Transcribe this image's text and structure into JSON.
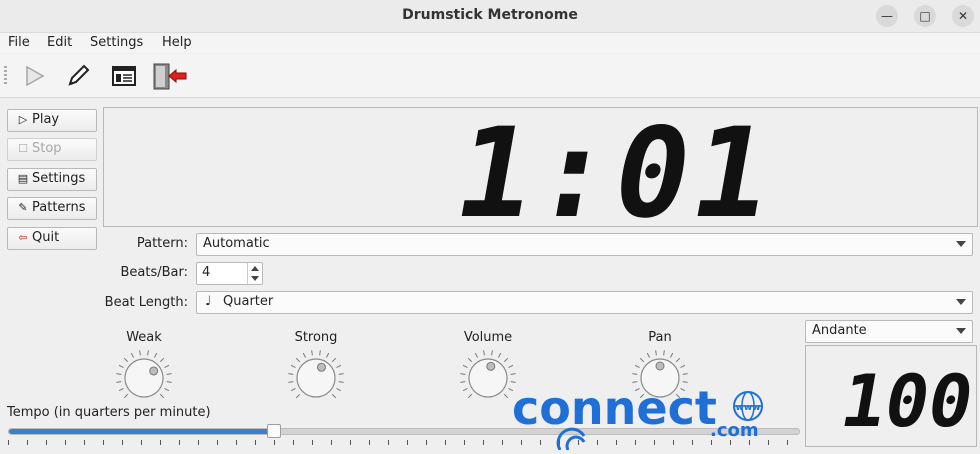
{
  "window": {
    "title": "Drumstick Metronome",
    "minimize_glyph": "—",
    "maximize_glyph": "□",
    "close_glyph": "✕"
  },
  "menubar": [
    "File",
    "Edit",
    "Settings",
    "Help"
  ],
  "toolbar": {
    "icons": [
      "play-icon",
      "pencil-icon",
      "settings-panel-icon",
      "exit-door-icon"
    ]
  },
  "side_buttons": [
    {
      "label": "Play",
      "icon": "▷",
      "enabled": true
    },
    {
      "label": "Stop",
      "icon": "☐",
      "enabled": false
    },
    {
      "label": "Settings",
      "icon": "▤",
      "enabled": true
    },
    {
      "label": "Patterns",
      "icon": "✎",
      "enabled": true
    },
    {
      "label": "Quit",
      "icon": "⇦",
      "enabled": true
    }
  ],
  "position_display": {
    "bar": "1",
    "separator": ":",
    "beat": "01"
  },
  "fields": {
    "pattern_label": "Pattern:",
    "pattern_value": "Automatic",
    "beats_label": "Beats/Bar:",
    "beats_value": "4",
    "beat_length_label": "Beat Length:",
    "beat_length_icon": "♩",
    "beat_length_value": "Quarter"
  },
  "dials": [
    {
      "label": "Weak",
      "level": 0.7
    },
    {
      "label": "Strong",
      "level": 0.6
    },
    {
      "label": "Volume",
      "level": 0.55
    },
    {
      "label": "Pan",
      "level": 0.5
    }
  ],
  "tempo": {
    "label": "Tempo (in quarters per minute)",
    "value": "100",
    "marking": "Andante",
    "slider_fraction": 0.335
  },
  "watermark": {
    "text": "connect",
    "domain": ".com",
    "www": "www"
  },
  "colors": {
    "accent": "#3d7fc9",
    "lcd": "#111111",
    "watermark": "#1f6fd6"
  }
}
